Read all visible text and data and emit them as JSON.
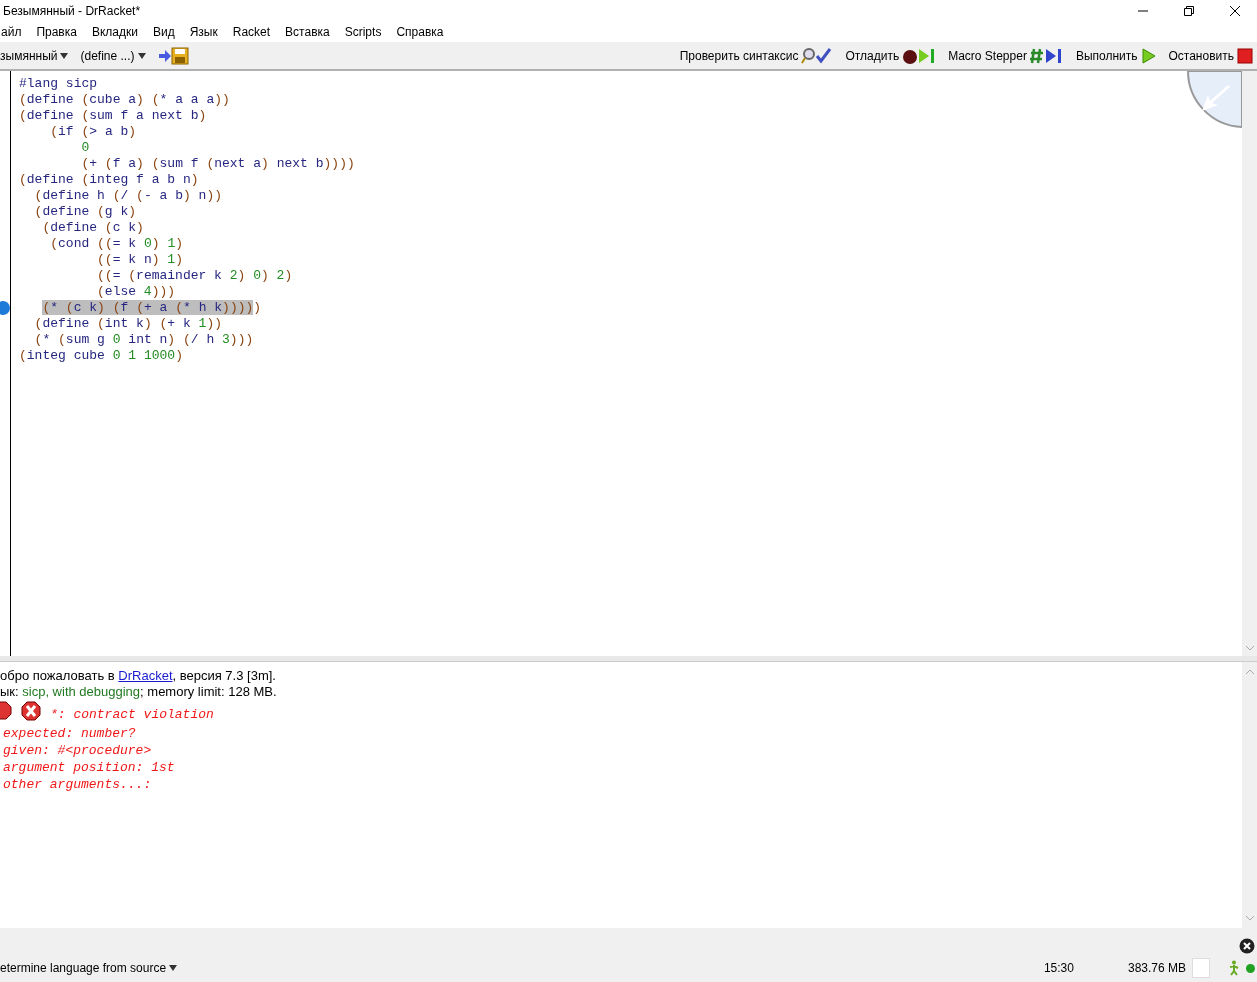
{
  "window": {
    "title": "Безымянный - DrRacket*"
  },
  "menu": [
    "айл",
    "Правка",
    "Вкладки",
    "Вид",
    "Язык",
    "Racket",
    "Вставка",
    "Scripts",
    "Справка"
  ],
  "toolbar": {
    "file_menu": "зымянный",
    "define_menu": "(define ...)",
    "buttons": [
      {
        "label": "Проверить синтаксис",
        "kind": "check"
      },
      {
        "label": "Отладить",
        "kind": "debug"
      },
      {
        "label": "Macro Stepper",
        "kind": "macro"
      },
      {
        "label": "Выполнить",
        "kind": "run"
      },
      {
        "label": "Остановить",
        "kind": "stop"
      }
    ]
  },
  "editor": {
    "lines": [
      {
        "breakpoint": false,
        "parts": [
          {
            "text": "#lang sicp",
            "highlighted": false
          }
        ]
      },
      {
        "breakpoint": false,
        "parts": [
          {
            "text": "(define (cube a) (* a a a))",
            "highlighted": false
          }
        ]
      },
      {
        "breakpoint": false,
        "parts": [
          {
            "text": "(define (sum f a next b)",
            "highlighted": false
          }
        ]
      },
      {
        "breakpoint": false,
        "parts": [
          {
            "text": "    (if (> a b)",
            "highlighted": false
          }
        ]
      },
      {
        "breakpoint": false,
        "parts": [
          {
            "text": "        0",
            "highlighted": false
          }
        ]
      },
      {
        "breakpoint": false,
        "parts": [
          {
            "text": "        (+ (f a) (sum f (next a) next b))))",
            "highlighted": false
          }
        ]
      },
      {
        "breakpoint": false,
        "parts": [
          {
            "text": "(define (integ f a b n)",
            "highlighted": false
          }
        ]
      },
      {
        "breakpoint": false,
        "parts": [
          {
            "text": "  (define h (/ (- a b) n))",
            "highlighted": false
          }
        ]
      },
      {
        "breakpoint": false,
        "parts": [
          {
            "text": "  (define (g k)",
            "highlighted": false
          }
        ]
      },
      {
        "breakpoint": false,
        "parts": [
          {
            "text": "   (define (c k)",
            "highlighted": false
          }
        ]
      },
      {
        "breakpoint": false,
        "parts": [
          {
            "text": "    (cond ((= k 0) 1)",
            "highlighted": false
          }
        ]
      },
      {
        "breakpoint": false,
        "parts": [
          {
            "text": "          ((= k n) 1)",
            "highlighted": false
          }
        ]
      },
      {
        "breakpoint": false,
        "parts": [
          {
            "text": "          ((= (remainder k 2) 0) 2)",
            "highlighted": false
          }
        ]
      },
      {
        "breakpoint": false,
        "parts": [
          {
            "text": "          (else 4)))",
            "highlighted": false
          }
        ]
      },
      {
        "breakpoint": true,
        "parts": [
          {
            "text": "   (* (c k) (f (+ a (* h k))))",
            "highlighted": true
          },
          {
            "text": ")",
            "highlighted": false
          }
        ]
      },
      {
        "breakpoint": false,
        "parts": [
          {
            "text": "  (define (int k) (+ k 1))",
            "highlighted": false
          }
        ]
      },
      {
        "breakpoint": false,
        "parts": [
          {
            "text": "  (* (sum g 0 int n) (/ h 3)))",
            "highlighted": false
          }
        ]
      },
      {
        "breakpoint": false,
        "parts": [
          {
            "text": "(integ cube 0 1 1000)",
            "highlighted": false
          }
        ]
      }
    ]
  },
  "interactions": {
    "welcome_before": "обро пожаловать в ",
    "welcome_link": "DrRacket",
    "welcome_after": ", версия 7.3 [3m].",
    "language_prefix": "ык: ",
    "language": "sicp, with debugging",
    "language_suffix": "; memory limit: 128 MB.",
    "error_lines": [
      "*: contract violation",
      "expected: number?",
      "given: #<procedure>",
      "argument position: 1st",
      "other arguments...:"
    ]
  },
  "status_bar": {
    "language": "etermine language from source",
    "position": "15:30",
    "memory": "383.76 MB"
  }
}
